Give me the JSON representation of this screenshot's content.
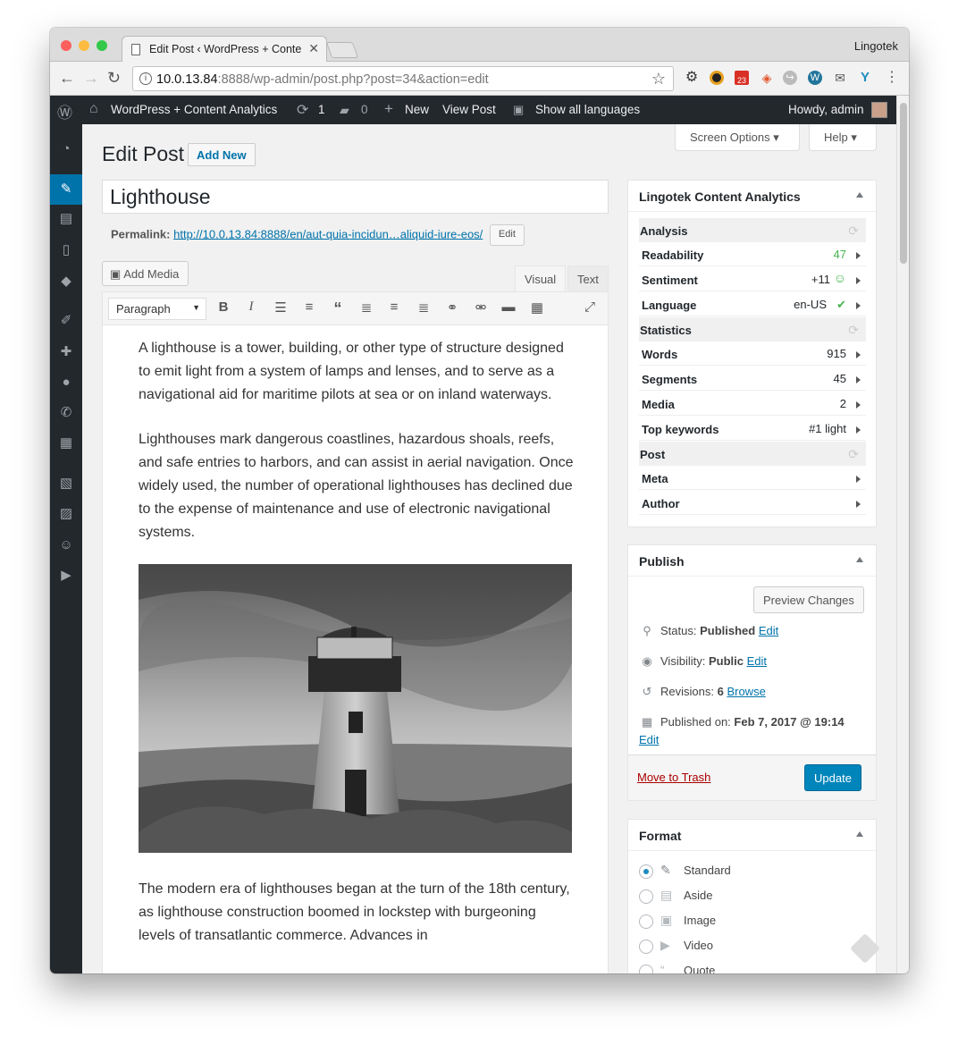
{
  "browser": {
    "tab_title": "Edit Post ‹ WordPress + Conte",
    "profile": "Lingotek",
    "url_host": "10.0.13.84",
    "url_rest": ":8888/wp-admin/post.php?post=34&action=edit",
    "calendar_badge": "23"
  },
  "adminbar": {
    "site_name": "WordPress + Content Analytics",
    "updates_count": "1",
    "comments_count": "0",
    "new_label": "New",
    "view_post": "View Post",
    "languages": "Show all languages",
    "howdy": "Howdy, admin"
  },
  "screen_options": "Screen Options",
  "help": "Help",
  "page": {
    "heading": "Edit Post",
    "add_new": "Add New",
    "post_title": "Lighthouse",
    "permalink_label": "Permalink:",
    "permalink_url": "http://10.0.13.84:8888/en/aut-quia-incidun…aliquid-iure-eos/",
    "permalink_edit": "Edit",
    "add_media": "Add Media",
    "tab_visual": "Visual",
    "tab_text": "Text",
    "format_select": "Paragraph",
    "paragraphs": [
      "A lighthouse is a tower, building, or other type of structure designed to emit light from a system of lamps and lenses, and to serve as a navigational aid for maritime pilots at sea or on inland waterways.",
      "Lighthouses mark dangerous coastlines, hazardous shoals, reefs, and safe entries to harbors, and can assist in aerial navigation. Once widely used, the number of operational lighthouses has declined due to the expense of maintenance and use of electronic navigational systems.",
      "The modern era of lighthouses began at the turn of the 18th century, as lighthouse construction boomed in lockstep with burgeoning levels of transatlantic commerce. Advances in"
    ]
  },
  "analytics": {
    "title": "Lingotek Content Analytics",
    "analysis": "Analysis",
    "readability_label": "Readability",
    "readability_value": "47",
    "sentiment_label": "Sentiment",
    "sentiment_value": "+11",
    "language_label": "Language",
    "language_value": "en-US",
    "statistics": "Statistics",
    "words_label": "Words",
    "words_value": "915",
    "segments_label": "Segments",
    "segments_value": "45",
    "media_label": "Media",
    "media_value": "2",
    "keywords_label": "Top keywords",
    "keywords_value": "#1 light",
    "post": "Post",
    "meta_label": "Meta",
    "author_label": "Author"
  },
  "publish": {
    "title": "Publish",
    "preview": "Preview Changes",
    "status_label": "Status:",
    "status_value": "Published",
    "visibility_label": "Visibility:",
    "visibility_value": "Public",
    "revisions_label": "Revisions:",
    "revisions_value": "6",
    "browse": "Browse",
    "published_label": "Published on:",
    "published_value": "Feb 7, 2017 @ 19:14",
    "edit": "Edit",
    "trash": "Move to Trash",
    "update": "Update"
  },
  "format": {
    "title": "Format",
    "options": [
      "Standard",
      "Aside",
      "Image",
      "Video",
      "Quote"
    ],
    "selected": "Standard"
  },
  "colors": {
    "wp_blue": "#0073aa",
    "admin_dark": "#23282d",
    "green": "#46b450"
  }
}
